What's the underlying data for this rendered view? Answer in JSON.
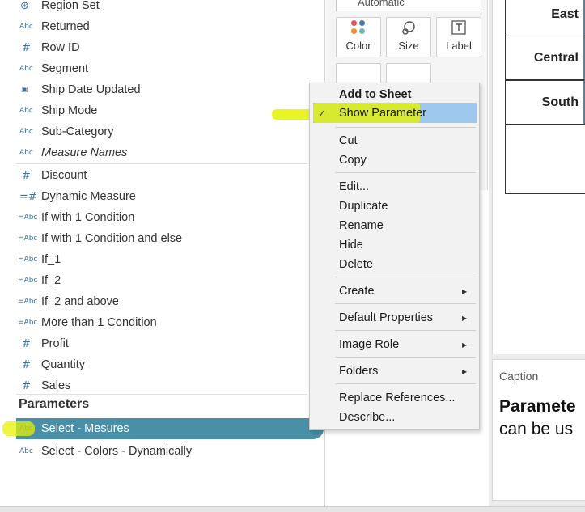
{
  "fields": [
    {
      "icon": "globe-link-icon",
      "icon_text": "⊛",
      "label": "Region Set"
    },
    {
      "icon": "string-icon",
      "icon_text": "Abc",
      "label": "Returned"
    },
    {
      "icon": "number-icon",
      "icon_text": "#",
      "label": "Row ID"
    },
    {
      "icon": "string-icon",
      "icon_text": "Abc",
      "label": "Segment"
    },
    {
      "icon": "calendar-icon",
      "icon_text": "▣",
      "label": "Ship Date Updated"
    },
    {
      "icon": "string-icon",
      "icon_text": "Abc",
      "label": "Ship Mode"
    },
    {
      "icon": "string-icon",
      "icon_text": "Abc",
      "label": "Sub-Category"
    },
    {
      "icon": "string-icon",
      "icon_text": "Abc",
      "label": "Measure Names"
    }
  ],
  "measures": [
    {
      "icon": "number-icon",
      "icon_text": "#",
      "label": "Discount"
    },
    {
      "icon": "calc-number-icon",
      "icon_text": "=#",
      "label": "Dynamic Measure"
    },
    {
      "icon": "calc-string-icon",
      "icon_text": "=Abc",
      "label": "If with 1 Condition"
    },
    {
      "icon": "calc-string-icon",
      "icon_text": "=Abc",
      "label": "If with 1 Condition and else"
    },
    {
      "icon": "calc-string-icon",
      "icon_text": "=Abc",
      "label": "If_1"
    },
    {
      "icon": "calc-string-icon",
      "icon_text": "=Abc",
      "label": "If_2"
    },
    {
      "icon": "calc-string-icon",
      "icon_text": "=Abc",
      "label": "If_2 and above"
    },
    {
      "icon": "calc-string-icon",
      "icon_text": "=Abc",
      "label": "More than 1 Condition"
    },
    {
      "icon": "number-icon",
      "icon_text": "#",
      "label": "Profit"
    },
    {
      "icon": "number-icon",
      "icon_text": "#",
      "label": "Quantity"
    },
    {
      "icon": "number-icon",
      "icon_text": "#",
      "label": "Sales"
    }
  ],
  "parameters": {
    "heading": "Parameters",
    "items": [
      {
        "icon": "string-icon",
        "icon_text": "Abc",
        "label": "Select -  Mesures",
        "selected": true
      },
      {
        "icon": "string-icon",
        "icon_text": "Abc",
        "label": "Select - Colors - Dynamically",
        "selected": false
      }
    ]
  },
  "marks": {
    "type_value": "Automatic",
    "buttons": [
      {
        "name": "color",
        "label": "Color"
      },
      {
        "name": "size",
        "label": "Size"
      },
      {
        "name": "label",
        "label": "Label"
      }
    ]
  },
  "view": {
    "regions": [
      "East",
      "Central",
      "South",
      ""
    ]
  },
  "caption": {
    "title": "Caption",
    "bold_text": "Paramete",
    "body_text": "can be us"
  },
  "context_menu": {
    "items": [
      {
        "label": "Add to Sheet",
        "bold": true
      },
      {
        "label": "Show Parameter",
        "checked": true,
        "hover": true
      },
      {
        "label": "Cut"
      },
      {
        "label": "Copy"
      },
      {
        "label": "Edit..."
      },
      {
        "label": "Duplicate"
      },
      {
        "label": "Rename"
      },
      {
        "label": "Hide"
      },
      {
        "label": "Delete"
      },
      {
        "label": "Create",
        "submenu": true
      },
      {
        "label": "Default Properties",
        "submenu": true
      },
      {
        "label": "Image Role",
        "submenu": true
      },
      {
        "label": "Folders",
        "submenu": true
      },
      {
        "label": "Replace References..."
      },
      {
        "label": "Describe..."
      }
    ],
    "check_glyph": "✓",
    "arrow_glyph": "▶"
  },
  "colors": {
    "selection": "#4a8fa8",
    "hover": "#9fc8ee",
    "highlighter": "#e5f200",
    "type_icon": "#3d6f98"
  }
}
